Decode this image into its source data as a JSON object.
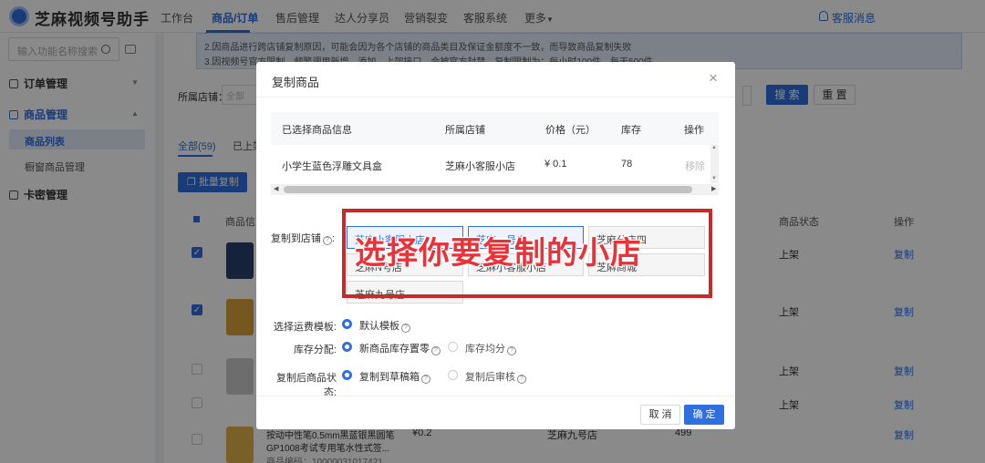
{
  "app": {
    "name": "芝麻视频号助手",
    "notify_label": "客服消息"
  },
  "nav": [
    {
      "label": "工作台"
    },
    {
      "label": "商品/订单",
      "active": true
    },
    {
      "label": "售后管理"
    },
    {
      "label": "达人分享员"
    },
    {
      "label": "营销裂变"
    },
    {
      "label": "客服系统"
    },
    {
      "label": "更多"
    }
  ],
  "sidebar": {
    "search_placeholder": "输入功能名称搜索",
    "groups": [
      {
        "label": "订单管理"
      },
      {
        "label": "商品管理",
        "items": [
          {
            "label": "商品列表",
            "active": true
          },
          {
            "label": "橱窗商品管理"
          }
        ]
      },
      {
        "label": "卡密管理"
      }
    ]
  },
  "notice": {
    "line2": "2.因商品进行跨店铺复制原因，可能会因为各个店铺的商品类目及保证金额度不一致，而导致商品复制失败",
    "line3": "3.因视频号官方限制，频繁调用新增、添加、上架接口，会被官方封禁。复制限制为：每小时100件，每天500件"
  },
  "filter": {
    "shop_label": "所属店铺：",
    "shop_placeholder": "全部",
    "search_button": "搜 索",
    "reset_button": "重 置"
  },
  "tabs": [
    {
      "label": "全部(59)",
      "active": true
    },
    {
      "label": "已上架"
    }
  ],
  "batch_button": "批量复制",
  "table": {
    "headers": {
      "product": "商品信息",
      "status": "商品状态",
      "action": "操作"
    },
    "rows": [
      {
        "checked": true,
        "status": "上架",
        "action": "复制"
      },
      {
        "checked": true,
        "status": "上架",
        "action": "复制"
      },
      {
        "checked": false,
        "status": "上架",
        "action": "复制"
      },
      {
        "checked": false,
        "status": "上架",
        "action": "复制"
      },
      {
        "checked": false,
        "name": "按动中性笔0.5mm黑蓝银黑圆笔",
        "name2": "GP1008考试专用笔水性式签...",
        "code": "商品编码：10000031017421",
        "price": "¥0.2",
        "shop": "芝麻九号店",
        "stock": "499",
        "action": "复制"
      }
    ]
  },
  "modal": {
    "title": "复制商品",
    "close": "×",
    "product_table": {
      "headers": {
        "info": "已选择商品信息",
        "shop": "所属店铺",
        "price": "价格（元）",
        "stock": "库存",
        "op": "操作"
      },
      "row": {
        "name": "小学生蓝色浮雕文具盒",
        "shop": "芝麻小客服小店",
        "price": "¥ 0.1",
        "stock": "78",
        "op": "移除"
      }
    },
    "copy_to_label": "复制到店铺",
    "shops": [
      {
        "label": "芝麻小客服小店",
        "selected": true
      },
      {
        "label": "芝麻一号店",
        "selected": true
      },
      {
        "label": "芝麻分店四"
      },
      {
        "label": "芝麻N号店"
      },
      {
        "label": "芝麻小客服小店"
      },
      {
        "label": "芝麻商城"
      },
      {
        "label": "芝麻九号店"
      }
    ],
    "shipping_label": "选择运费模板:",
    "shipping_option": "默认模板",
    "stock_label": "库存分配:",
    "stock_opt1": "新商品库存置零",
    "stock_opt2": "库存均分",
    "status_label": "复制后商品状态:",
    "status_opt1": "复制到草稿箱",
    "status_opt2": "复制后审核",
    "cancel": "取 消",
    "ok": "确 定"
  },
  "annotation": {
    "text": "选择你要复制的小店",
    "color": "#e8333a"
  },
  "colors": {
    "primary": "#2f6fe0",
    "annotation": "#c62a2a"
  }
}
